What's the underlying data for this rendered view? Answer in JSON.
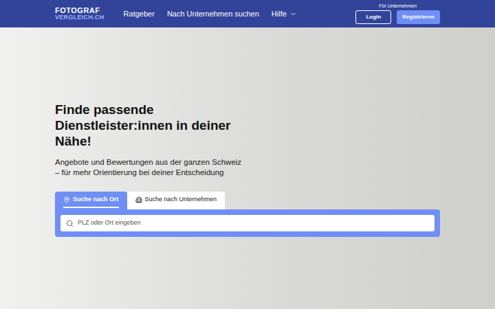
{
  "header": {
    "logo": {
      "line1": "FOTOGRAF",
      "line2": "VERGLEICH.CH"
    },
    "nav": [
      {
        "label": "Ratgeber",
        "dropdown": false
      },
      {
        "label": "Nach Unternehmen suchen",
        "dropdown": false
      },
      {
        "label": "Hilfe",
        "dropdown": true
      }
    ],
    "business": {
      "label": "Für Unternehmen",
      "buttons": [
        {
          "label": "Login",
          "kind": "outline"
        },
        {
          "label": "Registrieren",
          "kind": "filled"
        }
      ]
    }
  },
  "hero": {
    "title": "Finde passende Dienstleister:innen in deiner Nähe!",
    "subtitle": "Angebote und Bewertungen aus der ganzen Schweiz – für mehr Orientierung bei deiner Entscheidung",
    "tabs": [
      {
        "label": "Suche nach Ort",
        "kind": "location",
        "selected": true
      },
      {
        "label": "Suche nach Unternehmen",
        "kind": "company",
        "selected": false
      }
    ],
    "search": {
      "placeholder": "PLZ oder Ort eingeben"
    }
  }
}
